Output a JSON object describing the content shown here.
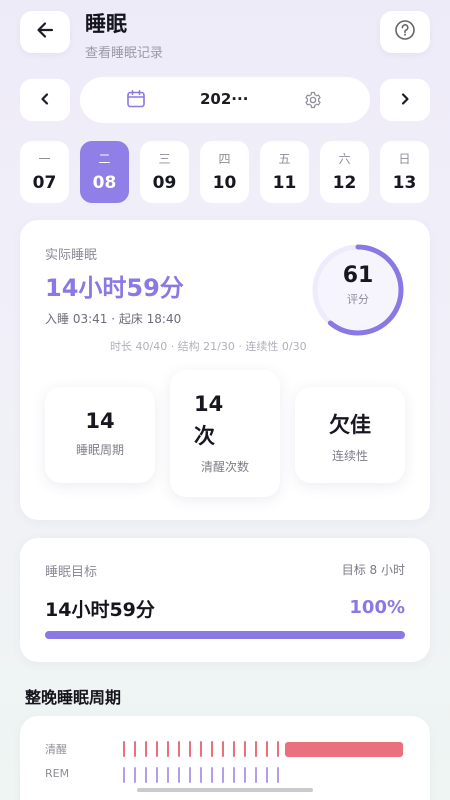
{
  "header": {
    "back_icon": "arrow-left-icon",
    "title": "睡眠",
    "subtitle": "查看睡眠记录",
    "help_icon": "question-circle-icon"
  },
  "date_bar": {
    "prev_icon": "chevron-left-icon",
    "calendar_icon": "calendar-icon",
    "date_text": "202···",
    "settings_icon": "gear-icon",
    "next_icon": "chevron-right-icon"
  },
  "week": [
    {
      "weekday": "一",
      "date": "07"
    },
    {
      "weekday": "二",
      "date": "08",
      "selected": true
    },
    {
      "weekday": "三",
      "date": "09"
    },
    {
      "weekday": "四",
      "date": "10"
    },
    {
      "weekday": "五",
      "date": "11"
    },
    {
      "weekday": "六",
      "date": "12"
    },
    {
      "weekday": "日",
      "date": "13"
    }
  ],
  "summary": {
    "label": "实际睡眠",
    "duration": "14小时59分",
    "times": "入睡 03:41 · 起床 18:40",
    "score_value": "61",
    "score_label": "评分",
    "score_fraction": 0.61,
    "breakdown": "时长 40/40 · 结构 21/30 · 连续性 0/30",
    "stats": [
      {
        "value": "14",
        "label": "睡眠周期"
      },
      {
        "value": "14次",
        "label": "清醒次数"
      },
      {
        "value": "欠佳",
        "label": "连续性"
      }
    ]
  },
  "goal": {
    "label": "睡眠目标",
    "target": "目标 8 小时",
    "duration": "14小时59分",
    "percent": "100%",
    "progress": 1.0
  },
  "cycles": {
    "title": "整晚睡眠周期",
    "rows": [
      {
        "label": "清醒",
        "ticks": 15
      },
      {
        "label": "REM",
        "ticks": 15
      }
    ]
  },
  "colors": {
    "accent": "#8a78e4",
    "awake": "#e8707f",
    "rem": "#b29cee"
  }
}
